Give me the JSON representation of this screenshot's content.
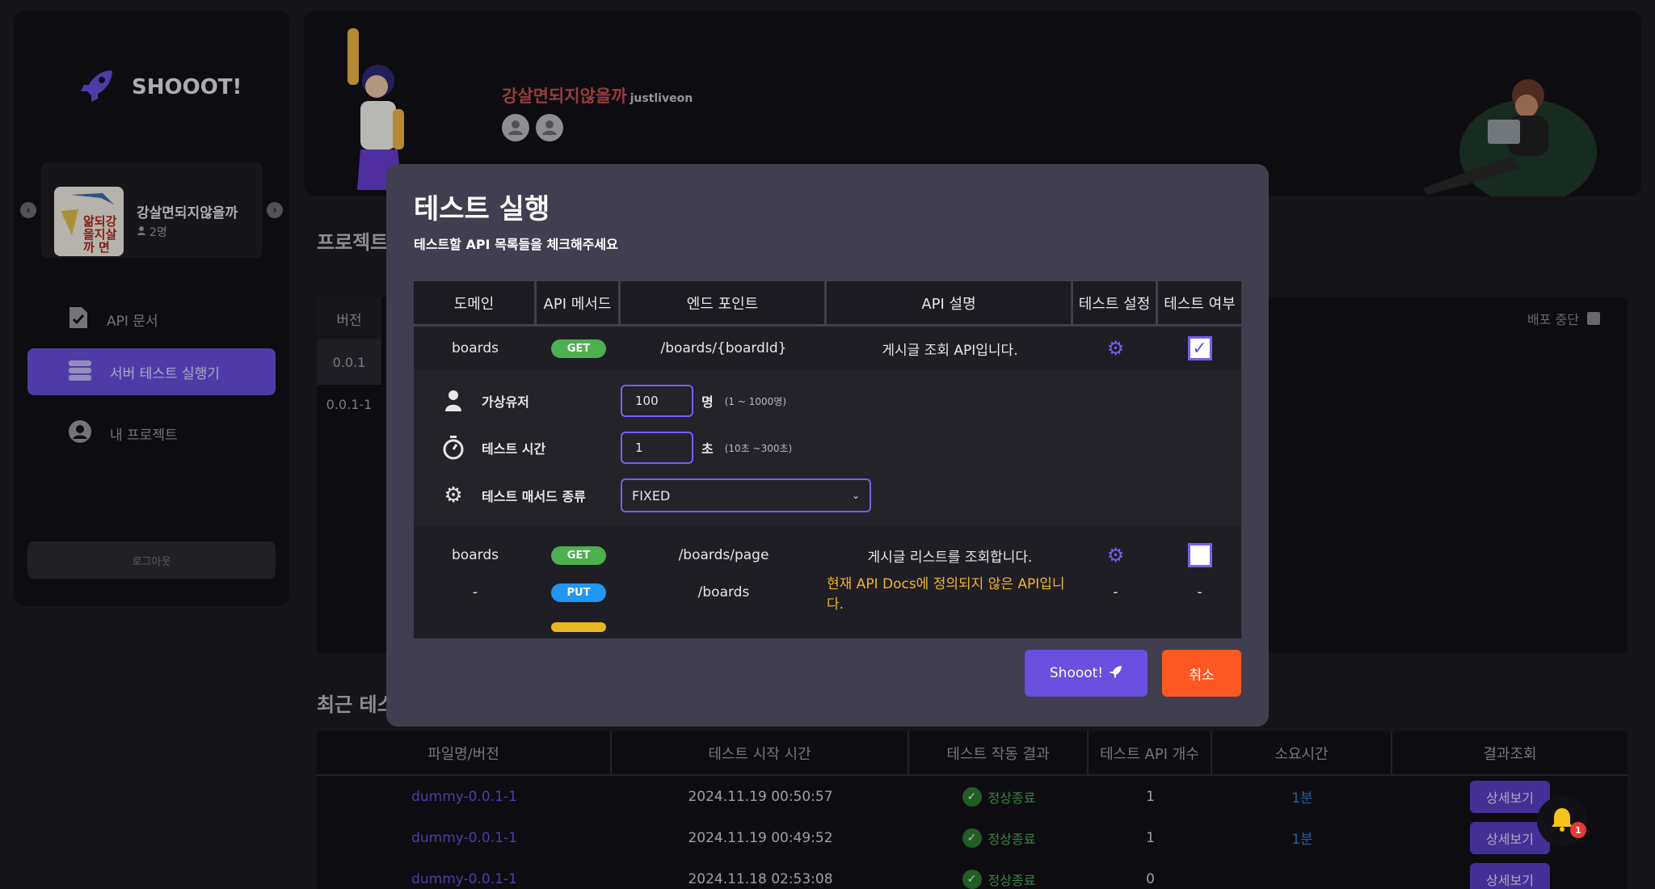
{
  "app": {
    "name": "SHOOOT!"
  },
  "sidebar": {
    "project": {
      "name": "강살면되지않을까",
      "members": "2명",
      "thumb_text": "앎되강\n을지살\n까  면"
    },
    "items": [
      {
        "label": "API 문서",
        "icon": "document-icon",
        "active": false
      },
      {
        "label": "서버 테스트 실행기",
        "icon": "server-icon",
        "active": true
      },
      {
        "label": "내 프로젝트",
        "icon": "user-circle-icon",
        "active": false
      }
    ],
    "logout_label": "로그아웃"
  },
  "banner": {
    "title": "강살면되지않을까",
    "subtitle": "justliveon"
  },
  "background": {
    "project_section_title": "프로젝트",
    "version_header": "버전",
    "versions": [
      "0.0.1",
      "0.0.1-1"
    ],
    "deploy_stop_label": "배포 중단",
    "recent_section_title": "최근 테스"
  },
  "recent_table": {
    "headers": [
      "파일명/버전",
      "테스트 시작 시간",
      "테스트 작동 결과",
      "테스트 API 개수",
      "소요시간",
      "결과조회"
    ],
    "rows": [
      {
        "file": "dummy-0.0.1-1",
        "start": "2024.11.19 00:50:57",
        "result": "정상종료",
        "api_count": "1",
        "duration": "1분",
        "action": "상세보기"
      },
      {
        "file": "dummy-0.0.1-1",
        "start": "2024.11.19 00:49:52",
        "result": "정상종료",
        "api_count": "1",
        "duration": "1분",
        "action": "상세보기"
      },
      {
        "file": "dummy-0.0.1-1",
        "start": "2024.11.18 02:53:08",
        "result": "정상종료",
        "api_count": "0",
        "duration": "",
        "action": "상세보기"
      }
    ]
  },
  "modal": {
    "title": "테스트 실행",
    "subtitle": "테스트할 API 목록들을 체크해주세요",
    "headers": [
      "도메인",
      "API 메서드",
      "엔드 포인트",
      "API 설명",
      "테스트 설정",
      "테스트 여부"
    ],
    "rows": [
      {
        "domain": "boards",
        "method": "GET",
        "endpoint": "/boards/{boardId}",
        "description": "게시글 조회 API입니다.",
        "setting": "gear",
        "checked": true
      },
      {
        "domain": "boards",
        "method": "GET",
        "endpoint": "/boards/page",
        "description": "게시글 리스트를 조회합니다.",
        "setting": "gear",
        "checked": false
      },
      {
        "domain": "-",
        "method": "PUT",
        "endpoint": "/boards",
        "description": "현재 API Docs에 정의되지 않은 API입니다.",
        "setting": "-",
        "checked": "-"
      }
    ],
    "settings": {
      "virtual_users": {
        "label": "가상유저",
        "value": "100",
        "unit": "명",
        "range": "(1 ~ 1000명)"
      },
      "test_time": {
        "label": "테스트 시간",
        "value": "1",
        "unit": "초",
        "range": "(10초 ~300초)"
      },
      "method_type": {
        "label": "테스트 매서드 종류",
        "value": "FIXED"
      }
    },
    "shoot_label": "Shooot!",
    "cancel_label": "취소"
  },
  "notifications": {
    "count": "1"
  },
  "colors": {
    "accent": "#6a4fe0",
    "cancel": "#ff5722",
    "get": "#4caf50",
    "put": "#2196f3",
    "warn": "#f0b429"
  }
}
